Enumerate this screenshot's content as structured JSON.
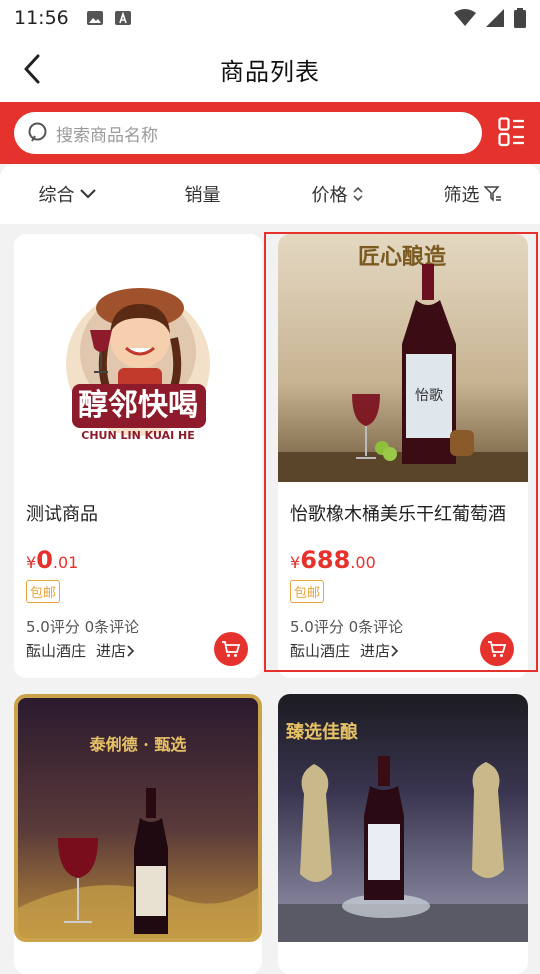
{
  "status": {
    "time": "11:56"
  },
  "header": {
    "title": "商品列表"
  },
  "search": {
    "placeholder": "搜索商品名称"
  },
  "filters": [
    {
      "label": "综合"
    },
    {
      "label": "销量"
    },
    {
      "label": "价格"
    },
    {
      "label": "筛选"
    }
  ],
  "products": [
    {
      "name": "测试商品",
      "price_symbol": "¥",
      "price_int": "0",
      "price_dec": ".01",
      "tag": "包邮",
      "rating": "5.0评分 0条评论",
      "shop": "酝山酒庄",
      "enter": "进店",
      "image": {
        "logo_cn": "醇邻快喝",
        "logo_en": "CHUN LIN KUAI HE"
      }
    },
    {
      "name": "怡歌橡木桶美乐干红葡萄酒",
      "price_symbol": "¥",
      "price_int": "688",
      "price_dec": ".00",
      "tag": "包邮",
      "rating": "5.0评分 0条评论",
      "shop": "酝山酒庄",
      "enter": "进店",
      "image": {
        "banner": "匠心酿造",
        "bottle_label": "怡歌"
      }
    },
    {
      "image": {
        "banner": "泰俐德 · 甄选"
      }
    },
    {
      "image": {
        "banner": "臻选佳酿"
      }
    }
  ],
  "colors": {
    "brand_red": "#e5322d",
    "tag_orange": "#e8a33a"
  }
}
